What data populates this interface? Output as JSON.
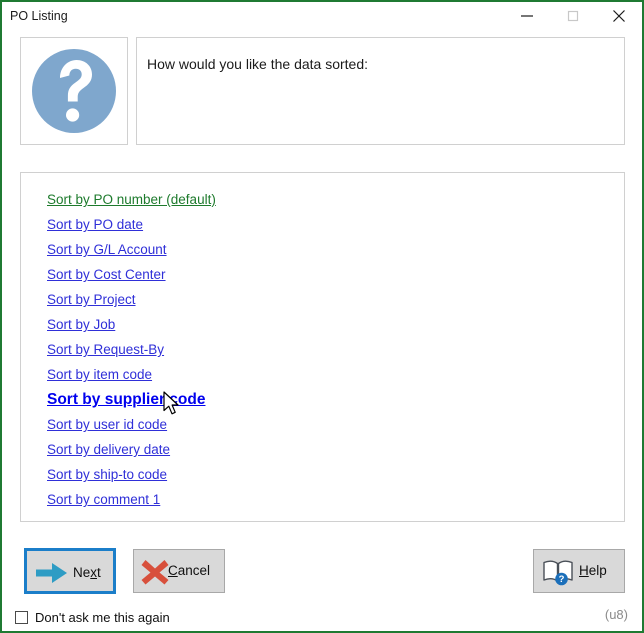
{
  "window": {
    "title": "PO Listing",
    "border_color": "#1f7a32",
    "controls": [
      {
        "name": "minimize",
        "glyph": "minimize-icon"
      },
      {
        "name": "maximize",
        "glyph": "maximize-icon"
      },
      {
        "name": "close",
        "glyph": "close-icon"
      }
    ]
  },
  "header": {
    "icon": "question-mark-icon",
    "icon_color": "#7fa7cd",
    "prompt": "How would you like the data sorted:"
  },
  "sort_options": [
    {
      "label": "Sort by PO number (default)",
      "state": "default",
      "color": "#1d7a2c"
    },
    {
      "label": "Sort by PO date",
      "state": "normal",
      "color": "#2f2fd8"
    },
    {
      "label": "Sort by G/L Account",
      "state": "normal",
      "color": "#2f2fd8"
    },
    {
      "label": "Sort by Cost Center",
      "state": "normal",
      "color": "#2f2fd8"
    },
    {
      "label": "Sort by Project",
      "state": "normal",
      "color": "#2f2fd8"
    },
    {
      "label": "Sort by Job",
      "state": "normal",
      "color": "#2f2fd8"
    },
    {
      "label": "Sort by Request-By",
      "state": "normal",
      "color": "#2f2fd8"
    },
    {
      "label": "Sort by item code",
      "state": "normal",
      "color": "#2f2fd8"
    },
    {
      "label": "Sort by supplier code",
      "state": "hovered",
      "color": "#0000ee"
    },
    {
      "label": "Sort by user id code",
      "state": "normal",
      "color": "#2f2fd8"
    },
    {
      "label": "Sort by delivery date",
      "state": "normal",
      "color": "#2f2fd8"
    },
    {
      "label": "Sort by ship-to code",
      "state": "normal",
      "color": "#2f2fd8"
    },
    {
      "label": "Sort by comment 1",
      "state": "normal",
      "color": "#2f2fd8"
    }
  ],
  "buttons": {
    "next": {
      "label_pre": "Ne",
      "label_accel": "x",
      "label_post": "t",
      "icon": "arrow-right-icon",
      "icon_color": "#2e9cc4",
      "focused": true
    },
    "cancel": {
      "label_pre": "",
      "label_accel": "C",
      "label_post": "ancel",
      "icon": "red-x-icon",
      "icon_color": "#d8503c",
      "focused": false
    },
    "help": {
      "label_pre": "",
      "label_accel": "H",
      "label_post": "elp",
      "icon": "help-book-icon",
      "icon_color": "#1b6fba",
      "focused": false
    }
  },
  "footer": {
    "checkbox_label": "Don't ask me this again",
    "checkbox_checked": false,
    "code": "(u8)"
  }
}
